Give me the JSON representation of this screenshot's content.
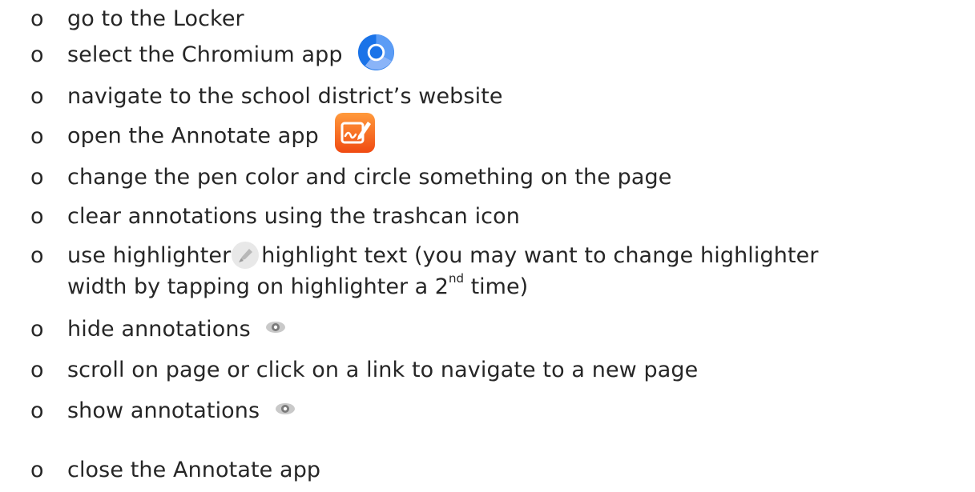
{
  "bullet": "o",
  "steps": [
    {
      "text": "go to the Locker"
    },
    {
      "text": "select the Chromium app",
      "icon": "chromium-icon"
    },
    {
      "text": "navigate to the school district’s website"
    },
    {
      "text": "open the Annotate app",
      "icon": "annotate-app-icon"
    },
    {
      "text": "change the pen color and circle something on the page"
    },
    {
      "text": "clear annotations using the trashcan icon"
    },
    {
      "text_before_icon": "use highlighter",
      "icon": "highlighter-icon",
      "text_after_icon": "highlight text (you may want to change highlighter",
      "continuation_before_sup": "width by tapping on highlighter a 2",
      "sup": "nd",
      "continuation_after_sup": " time)"
    },
    {
      "text": "hide annotations",
      "icon": "eye-icon"
    },
    {
      "text": "scroll on page or click on a link to navigate to a new page"
    },
    {
      "text": "show annotations",
      "icon": "eye-icon"
    },
    {
      "text": "close the Annotate app"
    }
  ],
  "colors": {
    "text": "#262626",
    "chromium_blue": "#1a73e8",
    "annotate_orange": "#f5631a"
  }
}
